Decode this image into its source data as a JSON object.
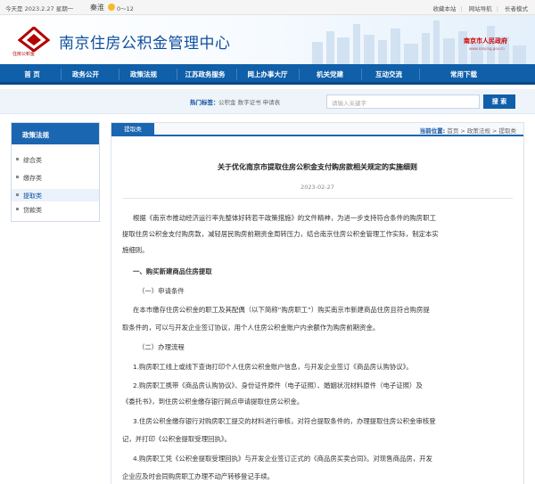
{
  "topbar": {
    "date": "今天是 2023.2.27 星期一",
    "city": "秦淮",
    "temp": "0～12",
    "links": [
      "收藏本站",
      "网站导航",
      "长者模式"
    ]
  },
  "header": {
    "logo_sub": "住房公积金",
    "site_title": "南京住房公积金管理中心",
    "gov_logo": "南京市人民政府",
    "gov_sub": "www.nanjing.gov.cn"
  },
  "nav": [
    "首 页",
    "政务公开",
    "政策法规",
    "江苏政务服务",
    "网上办事大厅",
    "机关党建",
    "互动交流",
    "常用下载"
  ],
  "search": {
    "hot_label": "热门标签：",
    "hot_words": "公积金  数字证书  申请表",
    "placeholder": "请输入关键字",
    "button": "搜 索"
  },
  "sidebar": {
    "title": "政策法规",
    "items": [
      "综合类",
      "缴存类",
      "提取类",
      "贷款类"
    ]
  },
  "content": {
    "tab": "提取类",
    "crumb_label": "当前位置:",
    "crumb_path": "首页 > 政策法规 > 提取类",
    "title": "关于优化南京市提取住房公积金支付购房款相关规定的实施细则",
    "date": "2023-02-27",
    "paragraphs": [
      "根据《南京市推动经济运行率先整体好转若干政策措施》的文件精神，为进一步支持符合条件的购房职工",
      "提取住房公积金支付购房款，减轻居民购房前期资金周转压力，结合南京住房公积金管理工作实际，制定本实",
      "施细则。"
    ],
    "section1": "一、购买新建商品住房提取",
    "sub1": "（一）申请条件",
    "cond": [
      "在本市缴存住房公积金的职工及其配偶（以下简称“购房职工”）购买南京市新建商品住房且符合购房提",
      "取条件的，可以与开发企业签订协议，用个人住房公积金账户内余额作为购房前期资金。"
    ],
    "sub2": "（二）办理流程",
    "steps": [
      "1.购房职工线上或线下查询打印个人住房公积金账户信息，与开发企业签订《商品房认购协议》。",
      "2.购房职工携带《商品房认购协议》、身份证件原件（电子证照）、婚姻状况材料原件（电子证照）及",
      "《委托书》，到住房公积金缴存银行网点申请提取住房公积金。",
      "3.住房公积金缴存银行对购房职工提交的材料进行审核，对符合提取条件的，办理提取住房公积金审核登",
      "记，并打印《公积金提取受理回执》。",
      "4.购房职工凭《公积金提取受理回执》与开发企业签订正式的《商品房买卖合同》。对现售商品房，开发",
      "企业应及时会同购房职工办理不动产转移登记手续。"
    ]
  }
}
